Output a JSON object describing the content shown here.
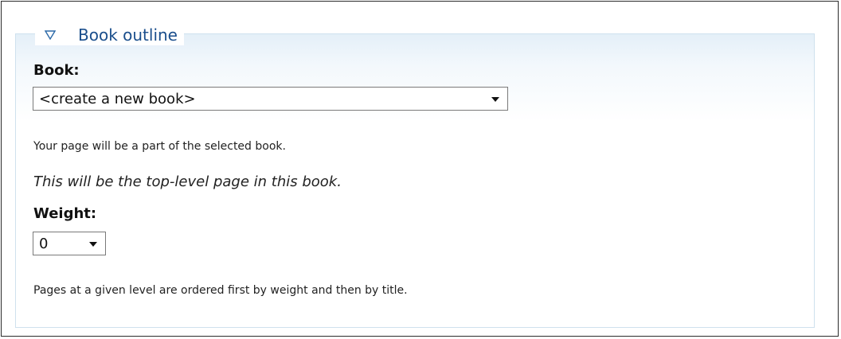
{
  "fieldset": {
    "legend": "Book outline"
  },
  "book": {
    "label": "Book:",
    "selected": "<create a new book>",
    "description": "Your page will be a part of the selected book.",
    "note": "This will be the top-level page in this book."
  },
  "weight": {
    "label": "Weight:",
    "selected": "0",
    "description": "Pages at a given level are ordered first by weight and then by title."
  },
  "colors": {
    "legend_text": "#1a4e8c",
    "fieldset_border": "#cfe1ee",
    "fieldset_gradient_top": "#e4eff8"
  },
  "icons": {
    "collapse": "triangle-down-outline",
    "dropdown": "caret-down"
  }
}
